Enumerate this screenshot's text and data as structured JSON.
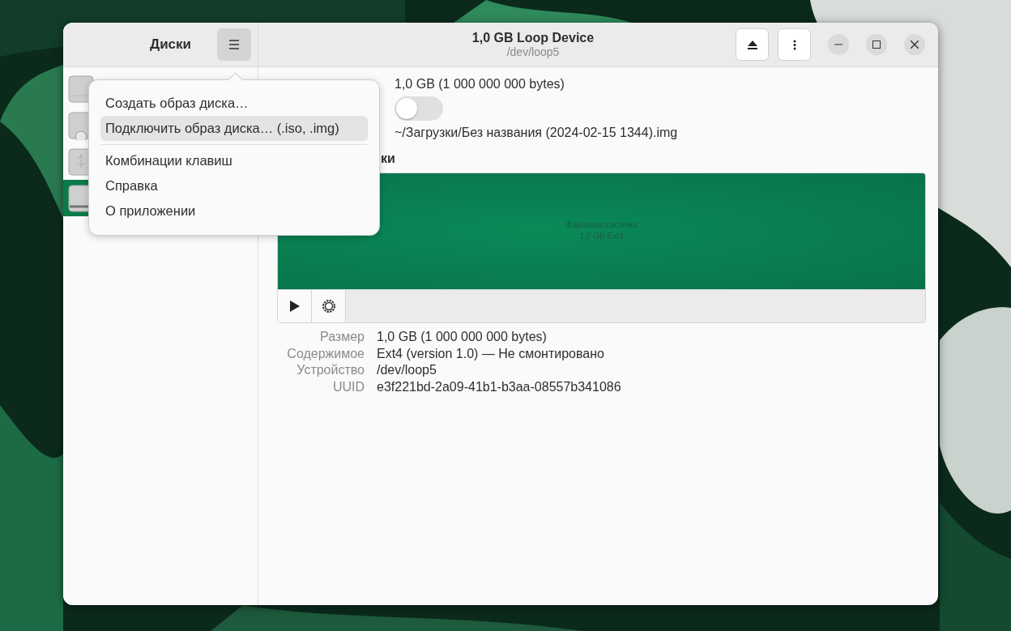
{
  "sidebar": {
    "title": "Диски",
    "items": [
      {
        "kind": "ssd",
        "selected": false
      },
      {
        "kind": "optical",
        "selected": false
      },
      {
        "kind": "usb",
        "selected": false
      },
      {
        "kind": "loop",
        "selected": true
      }
    ]
  },
  "header": {
    "title": "1,0 GB Loop Device",
    "subtitle": "/dev/loop5"
  },
  "menu": {
    "sections": [
      [
        {
          "label": "Создать образ диска…",
          "selected": false
        },
        {
          "label": "Подключить образ диска… (.iso, .img)",
          "selected": true
        }
      ],
      [
        {
          "label": "Комбинации клавиш",
          "selected": false
        },
        {
          "label": "Справка",
          "selected": false
        },
        {
          "label": "О приложении",
          "selected": false
        }
      ]
    ]
  },
  "info": {
    "size": "1,0 GB (1 000 000 000 bytes)",
    "autoclear_on": false,
    "backing_file": "~/Загрузки/Без названия (2024-02-15 1344).img"
  },
  "volumes": {
    "heading": "ки",
    "partition": {
      "line1": "Файловая система",
      "line2": "1,0 GB Ext4"
    }
  },
  "details": [
    {
      "label": "Размер",
      "value": "1,0 GB (1 000 000 000 bytes)"
    },
    {
      "label": "Содержимое",
      "value": "Ext4 (version 1.0) — Не смонтировано"
    },
    {
      "label": "Устройство",
      "value": "/dev/loop5"
    },
    {
      "label": "UUID",
      "value": "e3f221bd-2a09-41b1-b3aa-08557b341086"
    }
  ]
}
